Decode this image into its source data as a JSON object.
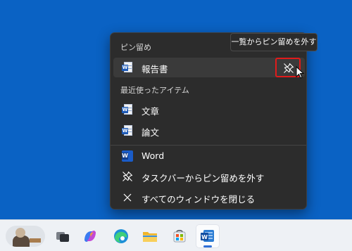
{
  "tooltip": {
    "text": "一覧からピン留めを外す"
  },
  "jumplist": {
    "pinned_header": "ピン留め",
    "pinned_items": [
      {
        "label": "報告書",
        "icon": "word-document-icon"
      }
    ],
    "recent_header": "最近使ったアイテム",
    "recent_items": [
      {
        "label": "文章",
        "icon": "word-document-icon"
      },
      {
        "label": "論文",
        "icon": "word-document-icon"
      }
    ],
    "app_name": "Word",
    "unpin_taskbar": "タスクバーからピン留めを外す",
    "close_all": "すべてのウィンドウを閉じる"
  },
  "taskbar": {
    "items": [
      "widgets",
      "task-view",
      "copilot",
      "edge",
      "file-explorer",
      "microsoft-store",
      "word"
    ],
    "active": "word"
  },
  "colors": {
    "desktop": "#0a62c4",
    "menu_bg": "#2c2c2c",
    "highlight_border": "#e01b1b",
    "word_blue": "#1a5cc8"
  }
}
